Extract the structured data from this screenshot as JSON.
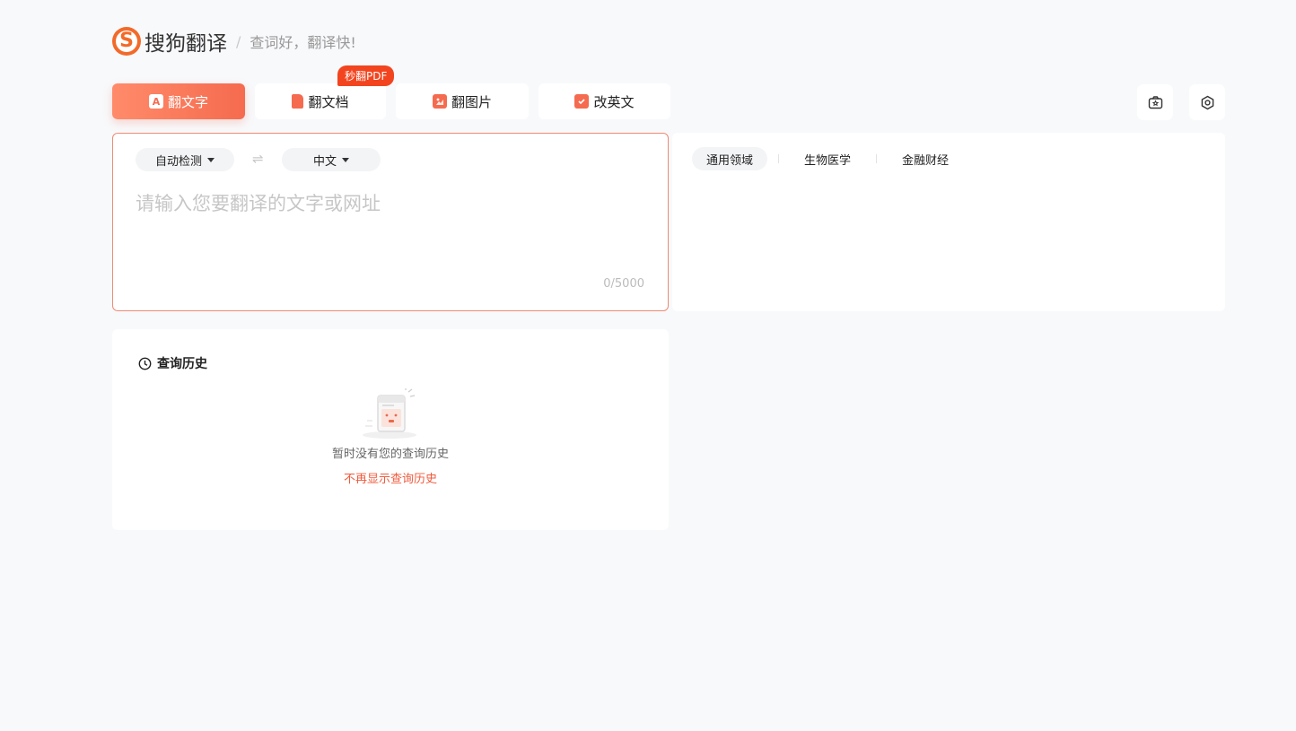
{
  "header": {
    "logo_mark": "S",
    "logo_text": "搜狗翻译",
    "divider": "/",
    "slogan": "查词好，翻译快!"
  },
  "tabs": [
    {
      "label": "翻文字",
      "icon": "letter-a-icon",
      "icon_text": "A",
      "active": true
    },
    {
      "label": "翻文档",
      "icon": "document-icon",
      "badge": "秒翻PDF"
    },
    {
      "label": "翻图片",
      "icon": "image-icon"
    },
    {
      "label": "改英文",
      "icon": "edit-check-icon"
    }
  ],
  "toolbar": {
    "camera_icon": "camera-icon",
    "settings_icon": "settings-gear-icon"
  },
  "input": {
    "source_lang": "自动检测",
    "swap_icon": "⇌",
    "target_lang": "中文",
    "placeholder": "请输入您要翻译的文字或网址",
    "value": "",
    "counter": "0/5000"
  },
  "output": {
    "domains": [
      {
        "label": "通用领域",
        "active": true
      },
      {
        "label": "生物医学"
      },
      {
        "label": "金融财经"
      }
    ]
  },
  "history": {
    "title": "查询历史",
    "empty_text": "暂时没有您的查询历史",
    "hide_link": "不再显示查询历史"
  },
  "colors": {
    "accent": "#f56b4f",
    "accent_light": "#ff8b6a",
    "badge": "#f2451f",
    "logo": "#f26a2a",
    "background": "#f8f9fb"
  }
}
